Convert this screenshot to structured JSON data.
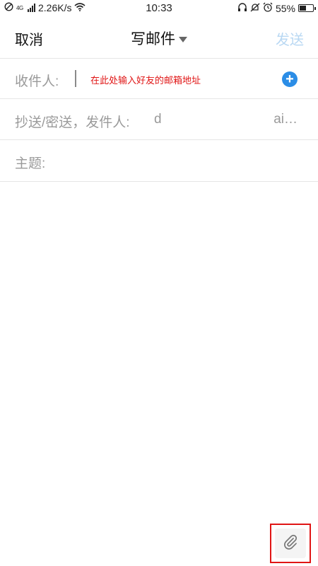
{
  "status_bar": {
    "network_small": "4G",
    "speed": "2.26K/s",
    "time": "10:33",
    "battery": "55%",
    "battery_level": 0.55
  },
  "header": {
    "cancel_label": "取消",
    "title": "写邮件",
    "send_label": "发送"
  },
  "recipient": {
    "label": "收件人:",
    "hint": "在此处输入好友的邮箱地址"
  },
  "cc_row": {
    "label": "抄送/密送，发件人:",
    "sender_value": "d",
    "account": "ai…"
  },
  "subject": {
    "label": "主题:",
    "value": ""
  },
  "colors": {
    "accent": "#2b8de6",
    "send_disabled": "#b9d8f3",
    "hint_red": "#e01515"
  },
  "icons": [
    "no-disturb-icon",
    "signal-icon",
    "wifi-icon",
    "headset-icon",
    "mute-icon",
    "alarm-icon",
    "battery-icon",
    "dropdown-caret-icon",
    "add-contact-icon",
    "paperclip-icon"
  ]
}
